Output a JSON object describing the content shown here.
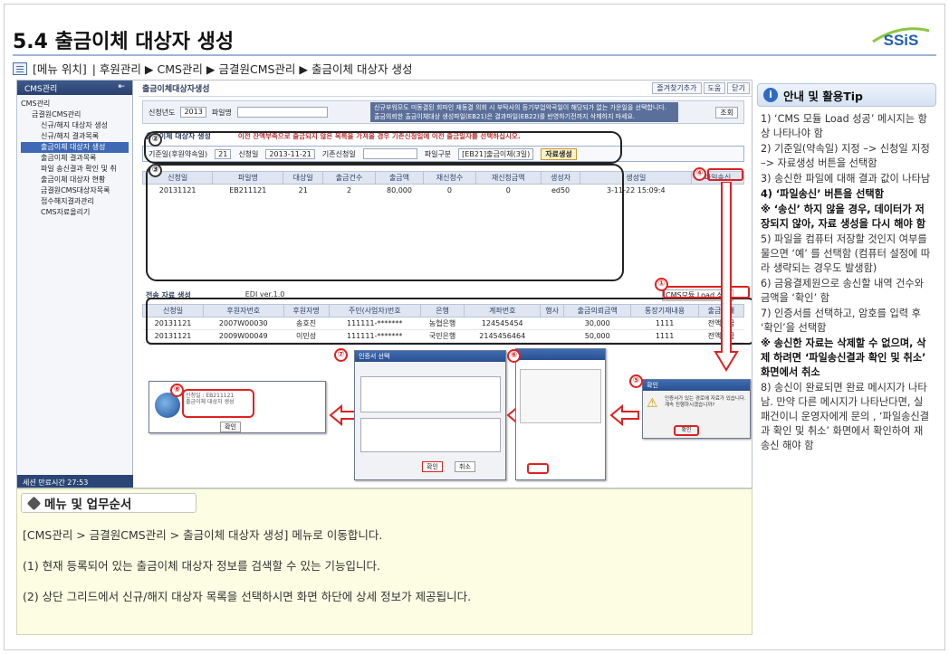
{
  "header": {
    "title": "5.4 출금이체 대상자 생성",
    "logo_text": "SSiS",
    "menu_position_label": "[메뉴 위치]",
    "menu_position_path": "| 후원관리 ▶ CMS관리 ▶ 금결원CMS관리 ▶ 출금이체 대상자 생성"
  },
  "sidebar": {
    "title": "CMS관리",
    "items": [
      {
        "label": "CMS관리"
      },
      {
        "label": "금결원CMS관리"
      },
      {
        "label": "신규/해지 대상자 생성"
      },
      {
        "label": "신규/해지 결과목록"
      },
      {
        "label": "출금이체 대상자 생성"
      },
      {
        "label": "출금이체 결과목록"
      },
      {
        "label": "파일 송신결과 확인 및 취"
      },
      {
        "label": "출금이체 대상자 현황"
      },
      {
        "label": "금결원CMS대상자목록"
      },
      {
        "label": "접수해지결과관리"
      },
      {
        "label": "CMS자료올리기"
      }
    ],
    "session_label": "세션 만료시간 27:53"
  },
  "app": {
    "page_title": "출금이체대상자생성",
    "top_buttons": [
      "즐겨찾기추가",
      "도움",
      "닫기"
    ],
    "search": {
      "year_label": "신청년도",
      "year_value": "2013",
      "file_label": "파일명",
      "search_btn": "조회"
    },
    "warning_lines": [
      "신규부워모도 미동결된 회파인 재동결 의회 시 부탁사의 등기부업악곡일이 해당되가 없는 가운일을 선택합니다.",
      "출금의뢰한 출금이체대상 생성파일(EB21)은 결과파일(EB22)를 반영하기전까지 삭제하지 마세요."
    ],
    "section1": "출금이체 대상자 생성",
    "section1_notice": "이전 잔액부족으로 출금되지 않은 목록을 가져올 경우 기존신청일에 이전 출금일자를 선택하십시오.",
    "cond": {
      "base_label": "기준일(후원약속일)",
      "base_value": "21",
      "apply_label": "신청일",
      "apply_value": "2013-11-21",
      "prev_label": "기존신청일",
      "filetype_label": "파일구분",
      "filetype_value": "[EB21]출금이체(3일)",
      "create_btn": "자료생성"
    },
    "grid1_headers": [
      "신청일",
      "파일명",
      "대상일",
      "출금건수",
      "출금액",
      "재신청수",
      "재신청금액",
      "생성자",
      "생성일",
      "파일송신"
    ],
    "grid1_rows": [
      [
        "20131121",
        "EB211121",
        "21",
        "2",
        "80,000",
        "0",
        "0",
        "ed50",
        "3-11-22 15:09:4",
        ""
      ]
    ],
    "section2": "전송 자료 생성",
    "edi_label": "EDI ver.1.0",
    "cms_load_btn": "CMS모듈 Load 성공",
    "grid2_headers": [
      "신청일",
      "후원자번호",
      "후원자명",
      "주민(사업자)번호",
      "은행",
      "계좌번호",
      "행사",
      "출금의뢰금액",
      "통장기재내용",
      "출금상태"
    ],
    "grid2_rows": [
      [
        "20131121",
        "2007W00030",
        "송호진",
        "111111-*******",
        "농협은행",
        "124545454",
        "",
        "30,000",
        "1111",
        "전액출금"
      ],
      [
        "20131121",
        "2009W00049",
        "이민성",
        "111111-*******",
        "국민은행",
        "2145456464",
        "",
        "50,000",
        "1111",
        "전액출금"
      ]
    ],
    "dialog5_title": "확인",
    "dialog5_text": "인증서가 있는 경로에 자료가 있습니다. 계속 진행하시겠습니까?",
    "dialog5_ok": "확인",
    "dialog7_title": "인증서 선택",
    "dialog7_ok": "확인",
    "dialog7_cancel": "취소",
    "dialog8_ok": "확인",
    "markers": [
      "①",
      "②",
      "③",
      "④",
      "⑤",
      "⑥",
      "⑦",
      "⑧"
    ]
  },
  "tips": {
    "title": "안내 및 활용Tip",
    "items": [
      "1) ‘CMS 모듈 Load 성공’ 메시지는 항상 나타나야 함",
      "2) 기준일(약속일) 지정 –> 신청일 지정 –> 자료생성 버튼을 선택함",
      "3) 송신한 파일에 대해 결과 값이 나타남",
      "4) ‘파일송신’ 버튼을 선택함",
      "※ ‘송신’ 하지 않을 경우, 데이터가 저장되지 않아, 자료 생성을 다시 해야 함",
      "5) 파일을 컴퓨터 저장할 것인지 여부를 물으면 ‘예’ 를 선택함 (컴퓨터 설정에 따라 생략되는 경우도 발생함)",
      "6) 금융결제원으로 송신할 내역 건수와 금액을 ‘확인’ 함",
      "7) 인증서를 선택하고, 암호를 입력 후 ‘확인’을 선택함",
      "※ 송신한 자료는 삭제할 수 없으며, 삭제 하려면 ‘파일송신결과 확인 및 취소’ 화면에서 취소",
      "8) 송신이 완료되면 완료 메시지가 나타남. 만약 다른 메시지가 나타난다면, 실패건이니 운영자에게 문의 , ‘파일송신결과 확인 및 취소’ 화면에서 확인하여 재송신 해야 함"
    ]
  },
  "order": {
    "title": "메뉴 및 업무순서",
    "lines": [
      "[CMS관리 > 금결원CMS관리 > 출금이체 대상자 생성] 메뉴로 이동합니다.",
      "(1) 현재 등록되어 있는 출금이체 대상자 정보를 검색할 수 있는 기능입니다.",
      "(2) 상단 그리드에서 신규/해지 대상자 목록을 선택하시면 화면 하단에 상세 정보가 제공됩니다."
    ]
  },
  "colors": {
    "accent": "#2f6cc1",
    "marker_red": "#e02020",
    "order_bg": "#fcfde3"
  }
}
